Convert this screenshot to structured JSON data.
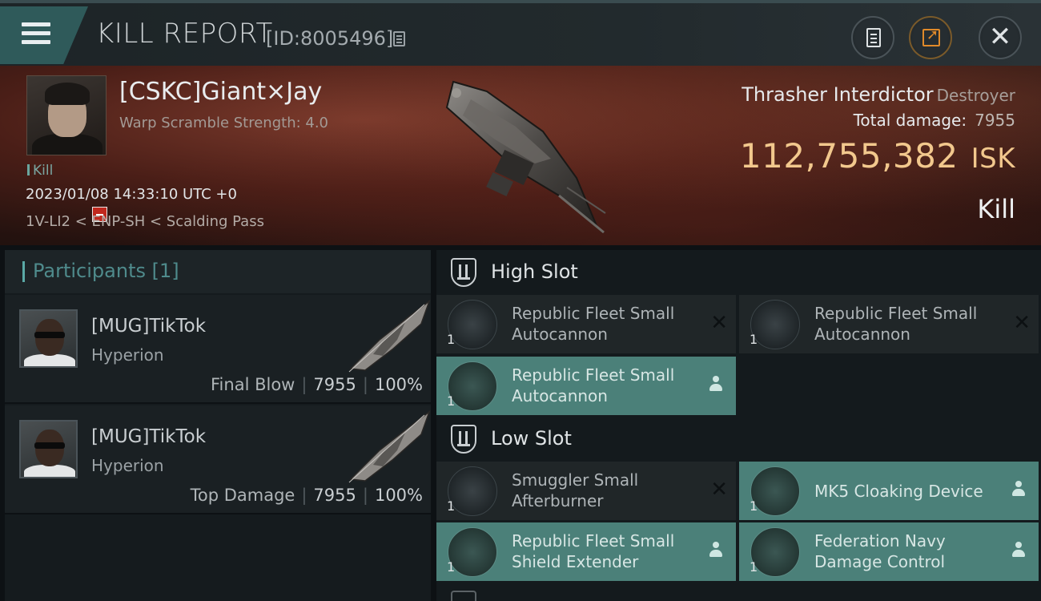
{
  "header": {
    "title": "KILL REPORT",
    "id_label": "[ID:8005496]"
  },
  "victim": {
    "name": "[CSKC]Giant×Jay",
    "warp_scramble": "Warp Scramble Strength: 4.0",
    "status_tag": "Kill",
    "timestamp": "2023/01/08 14:33:10 UTC +0",
    "location": "1V-LI2 < ENP-SH < Scalding Pass",
    "ship_name": "Thrasher Interdictor",
    "ship_class": "Destroyer",
    "total_damage_label": "Total damage:",
    "total_damage_value": "7955",
    "isk_value": "112,755,382",
    "isk_unit": "ISK",
    "result": "Kill"
  },
  "participants": {
    "label": "Participants [1]",
    "rows": [
      {
        "name": "[MUG]TikTok",
        "ship": "Hyperion",
        "role": "Final Blow",
        "damage": "7955",
        "percent": "100%"
      },
      {
        "name": "[MUG]TikTok",
        "ship": "Hyperion",
        "role": "Top Damage",
        "damage": "7955",
        "percent": "100%"
      }
    ]
  },
  "fittings": {
    "high_slot": {
      "title": "High Slot",
      "modules": [
        {
          "name": "Republic Fleet Small Autocannon",
          "line1": "Republic Fleet Small",
          "line2": "Autocannon",
          "qty": "1",
          "status": "destroyed",
          "icon": "autocannon-icon"
        },
        {
          "name": "Republic Fleet Small Autocannon",
          "line1": "Republic Fleet Small",
          "line2": "Autocannon",
          "qty": "1",
          "status": "destroyed",
          "icon": "autocannon-icon"
        },
        {
          "name": "Republic Fleet Small Autocannon",
          "line1": "Republic Fleet Small",
          "line2": "Autocannon",
          "qty": "1",
          "status": "dropped",
          "icon": "autocannon-icon"
        }
      ]
    },
    "low_slot": {
      "title": "Low Slot",
      "modules": [
        {
          "name": "Smuggler Small Afterburner",
          "line1": "Smuggler Small",
          "line2": "Afterburner",
          "qty": "1",
          "status": "destroyed",
          "icon": "afterburner-icon"
        },
        {
          "name": "MK5 Cloaking Device",
          "line1": "MK5 Cloaking Device",
          "line2": "",
          "qty": "1",
          "status": "dropped",
          "icon": "cloaking-device-icon"
        },
        {
          "name": "Republic Fleet Small Shield Extender",
          "line1": "Republic Fleet Small",
          "line2": "Shield Extender",
          "qty": "1",
          "status": "dropped",
          "icon": "shield-extender-icon"
        },
        {
          "name": "Federation Navy Damage Control",
          "line1": "Federation Navy",
          "line2": "Damage Control",
          "qty": "1",
          "status": "dropped",
          "icon": "damage-control-icon"
        }
      ]
    }
  },
  "colors": {
    "accent_teal": "#4b8079",
    "isk_gold": "#f2c88d",
    "banner_red": "#4a1e17",
    "share_orange": "#e08a2a"
  }
}
